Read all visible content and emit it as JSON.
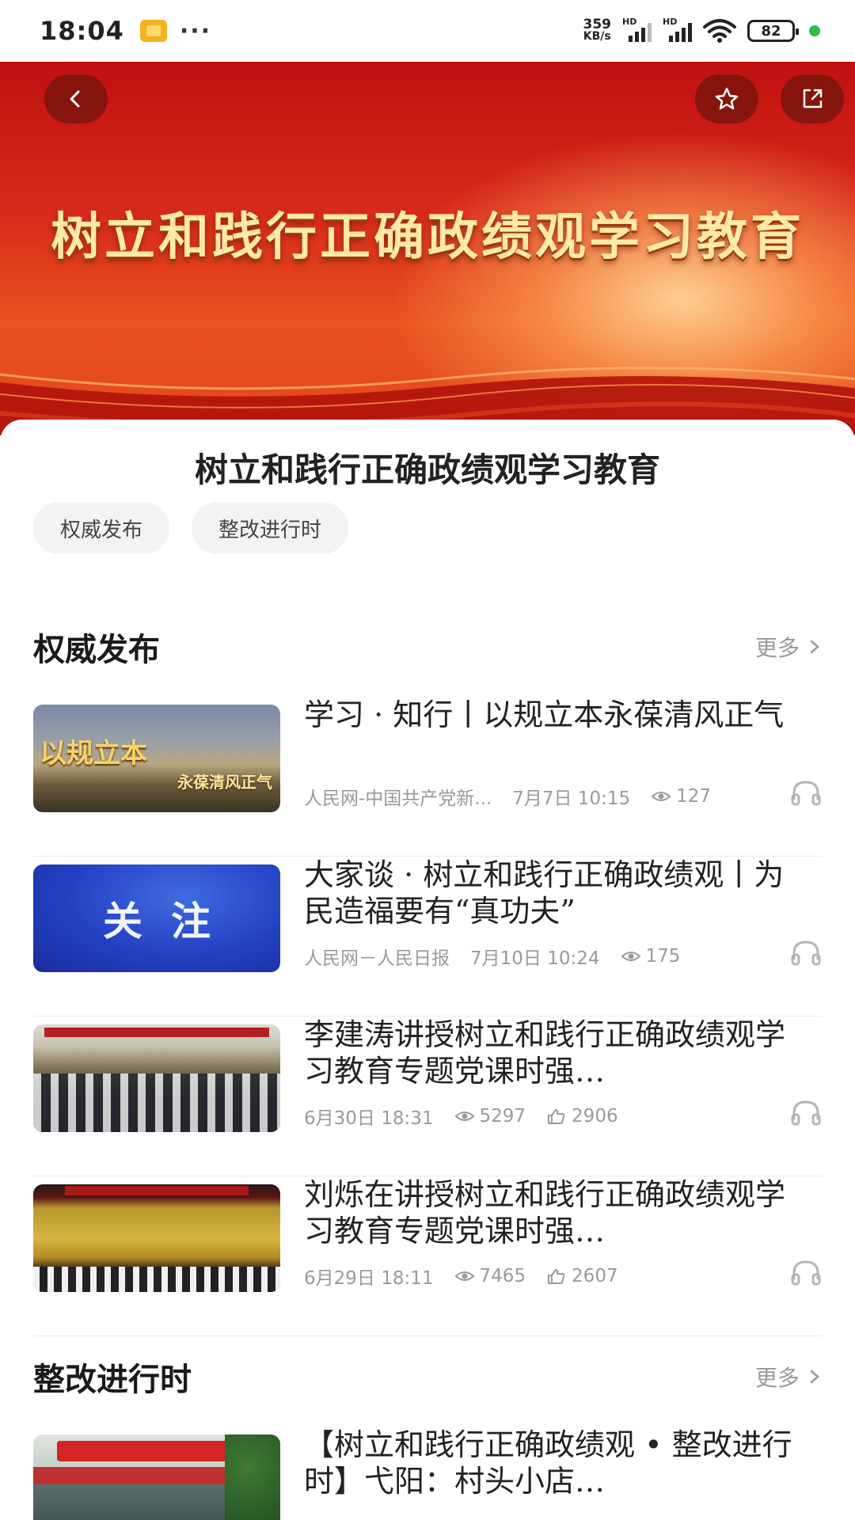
{
  "status_bar": {
    "time": "18:04",
    "net_speed_value": "359",
    "net_speed_unit": "KB/s",
    "signal_label_1": "HD",
    "signal_label_2": "HD",
    "battery": "82"
  },
  "banner": {
    "title": "树立和践行正确政绩观学习教育",
    "colors": {
      "primary_red": "#c01010",
      "gold_text": "#ffe9a8"
    }
  },
  "nav": {
    "back_icon": "chevron-left-icon",
    "favorite_icon": "star-icon",
    "share_icon": "share-icon"
  },
  "topic": {
    "title": "树立和践行正确政绩观学习教育",
    "chips": [
      "权威发布",
      "整改进行时"
    ]
  },
  "sections": [
    {
      "title": "权威发布",
      "more_label": "更多",
      "articles": [
        {
          "title": "学习 · 知行丨以规立本永葆清风正气",
          "thumb_text_big": "以规立本",
          "thumb_text_small": "永葆清风正气",
          "source": "人民网-中国共产党新...",
          "date": "7月7日  10:15",
          "views": "127"
        },
        {
          "title": "大家谈 · 树立和践行正确政绩观丨为民造福要有“真功夫”",
          "thumb_text_big": "关注",
          "source": "人民网－人民日报",
          "date": "7月10日  10:24",
          "views": "175"
        },
        {
          "title": "李建涛讲授树立和践行正确政绩观学习教育专题党课时强…",
          "date": "6月30日  18:31",
          "views": "5297",
          "likes": "2906"
        },
        {
          "title": "刘烁在讲授树立和践行正确政绩观学习教育专题党课时强…",
          "date": "6月29日  18:11",
          "views": "7465",
          "likes": "2607"
        }
      ]
    },
    {
      "title": "整改进行时",
      "more_label": "更多",
      "articles": [
        {
          "title": "【树立和践行正确政绩观 • 整改进行时】弋阳：村头小店…"
        }
      ]
    }
  ]
}
